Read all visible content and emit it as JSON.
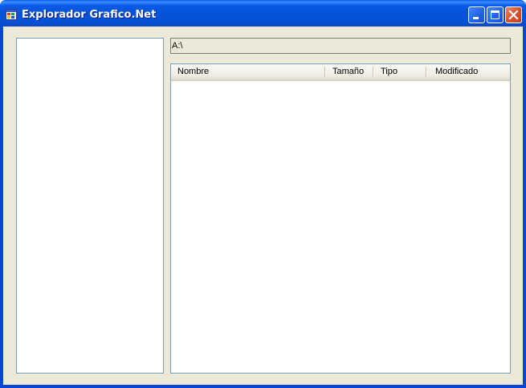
{
  "window": {
    "title": "Explorador Grafico.Net",
    "icon": "application-icon",
    "controls": {
      "minimize_icon": "minimize-icon",
      "maximize_icon": "maximize-icon",
      "close_icon": "close-icon"
    },
    "colors": {
      "titlebar": "#0653d9",
      "client": "#ece9d8",
      "close_button": "#d8532c"
    }
  },
  "address": {
    "value": "A:\\"
  },
  "file_list": {
    "columns": [
      {
        "label": "Nombre"
      },
      {
        "label": "Tamaño"
      },
      {
        "label": "Tipo"
      },
      {
        "label": "Modificado"
      }
    ],
    "rows": []
  },
  "folder_tree": {
    "items": []
  }
}
